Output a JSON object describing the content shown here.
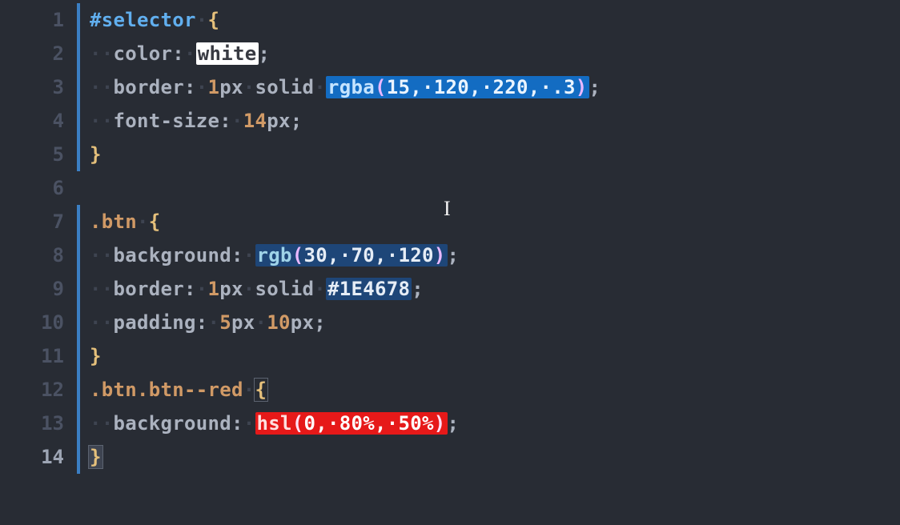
{
  "colors": {
    "background": "#282c34",
    "gutter": "#4b5263",
    "foldbar": "#3b7fc4",
    "sel": "#61afef",
    "class": "#d19a66",
    "brace": "#e5c07b",
    "num": "#d19a66",
    "func": "#56b6c2",
    "paren": "#c678dd"
  },
  "swatches": {
    "white": "#ffffff",
    "rgba": "rgba(15, 120, 220, .3)",
    "rgb": "rgb(30, 70, 120)",
    "hex": "#1E4678",
    "hsl": "hsl(0, 80%, 50%)"
  },
  "lines": [
    {
      "n": "1",
      "fold": true,
      "tokens": [
        {
          "t": "#selector",
          "c": "tk-sel"
        },
        {
          "t": "·",
          "c": "tk-ws"
        },
        {
          "t": "{",
          "c": "tk-brace"
        }
      ]
    },
    {
      "n": "2",
      "fold": true,
      "tokens": [
        {
          "t": "··",
          "c": "tk-ws"
        },
        {
          "t": "color",
          "c": "tk-prop"
        },
        {
          "t": ":",
          "c": "tk-punc"
        },
        {
          "t": "·",
          "c": "tk-ws"
        },
        {
          "sw": "sw-white",
          "inner": [
            {
              "t": "white",
              "c": "txt"
            }
          ]
        },
        {
          "t": ";",
          "c": "tk-punc"
        }
      ]
    },
    {
      "n": "3",
      "fold": true,
      "tokens": [
        {
          "t": "··",
          "c": "tk-ws"
        },
        {
          "t": "border",
          "c": "tk-prop"
        },
        {
          "t": ":",
          "c": "tk-punc"
        },
        {
          "t": "·",
          "c": "tk-ws"
        },
        {
          "t": "1",
          "c": "tk-num"
        },
        {
          "t": "px",
          "c": "tk-unit"
        },
        {
          "t": "·",
          "c": "tk-ws"
        },
        {
          "t": "solid",
          "c": "tk-keyw"
        },
        {
          "t": "·",
          "c": "tk-ws"
        },
        {
          "sw": "sw-rgba",
          "inner": [
            {
              "t": "rgba",
              "c": "tk-func"
            },
            {
              "t": "(",
              "c": "tk-paren"
            },
            {
              "t": "15",
              "c": "tk-num"
            },
            {
              "t": ",",
              "c": "txt"
            },
            {
              "t": "·",
              "c": "tk-ws"
            },
            {
              "t": "120",
              "c": "tk-num"
            },
            {
              "t": ",",
              "c": "txt"
            },
            {
              "t": "·",
              "c": "tk-ws"
            },
            {
              "t": "220",
              "c": "tk-num"
            },
            {
              "t": ",",
              "c": "txt"
            },
            {
              "t": "·",
              "c": "tk-ws"
            },
            {
              "t": ".3",
              "c": "tk-num"
            },
            {
              "t": ")",
              "c": "tk-paren"
            }
          ]
        },
        {
          "t": ";",
          "c": "tk-punc"
        }
      ]
    },
    {
      "n": "4",
      "fold": true,
      "tokens": [
        {
          "t": "··",
          "c": "tk-ws"
        },
        {
          "t": "font-size",
          "c": "tk-prop"
        },
        {
          "t": ":",
          "c": "tk-punc"
        },
        {
          "t": "·",
          "c": "tk-ws"
        },
        {
          "t": "14",
          "c": "tk-num"
        },
        {
          "t": "px",
          "c": "tk-unit"
        },
        {
          "t": ";",
          "c": "tk-punc"
        }
      ]
    },
    {
      "n": "5",
      "fold": true,
      "tokens": [
        {
          "t": "}",
          "c": "tk-brace"
        }
      ]
    },
    {
      "n": "6",
      "fold": false,
      "tokens": []
    },
    {
      "n": "7",
      "fold": true,
      "tokens": [
        {
          "t": ".btn",
          "c": "tk-class"
        },
        {
          "t": "·",
          "c": "tk-ws"
        },
        {
          "t": "{",
          "c": "tk-brace"
        }
      ]
    },
    {
      "n": "8",
      "fold": true,
      "tokens": [
        {
          "t": "··",
          "c": "tk-ws"
        },
        {
          "t": "background",
          "c": "tk-prop"
        },
        {
          "t": ":",
          "c": "tk-punc"
        },
        {
          "t": "·",
          "c": "tk-ws"
        },
        {
          "sw": "sw-rgb",
          "inner": [
            {
              "t": "rgb",
              "c": "tk-func"
            },
            {
              "t": "(",
              "c": "tk-paren"
            },
            {
              "t": "30",
              "c": "tk-num"
            },
            {
              "t": ",",
              "c": "txt"
            },
            {
              "t": "·",
              "c": "tk-ws"
            },
            {
              "t": "70",
              "c": "tk-num"
            },
            {
              "t": ",",
              "c": "txt"
            },
            {
              "t": "·",
              "c": "tk-ws"
            },
            {
              "t": "120",
              "c": "tk-num"
            },
            {
              "t": ")",
              "c": "tk-paren"
            }
          ]
        },
        {
          "t": ";",
          "c": "tk-punc"
        }
      ]
    },
    {
      "n": "9",
      "fold": true,
      "tokens": [
        {
          "t": "··",
          "c": "tk-ws"
        },
        {
          "t": "border",
          "c": "tk-prop"
        },
        {
          "t": ":",
          "c": "tk-punc"
        },
        {
          "t": "·",
          "c": "tk-ws"
        },
        {
          "t": "1",
          "c": "tk-num"
        },
        {
          "t": "px",
          "c": "tk-unit"
        },
        {
          "t": "·",
          "c": "tk-ws"
        },
        {
          "t": "solid",
          "c": "tk-keyw"
        },
        {
          "t": "·",
          "c": "tk-ws"
        },
        {
          "sw": "sw-hex",
          "inner": [
            {
              "t": "#1E4678",
              "c": "txt"
            }
          ]
        },
        {
          "t": ";",
          "c": "tk-punc"
        }
      ]
    },
    {
      "n": "10",
      "fold": true,
      "tokens": [
        {
          "t": "··",
          "c": "tk-ws"
        },
        {
          "t": "padding",
          "c": "tk-prop"
        },
        {
          "t": ":",
          "c": "tk-punc"
        },
        {
          "t": "·",
          "c": "tk-ws"
        },
        {
          "t": "5",
          "c": "tk-num"
        },
        {
          "t": "px",
          "c": "tk-unit"
        },
        {
          "t": "·",
          "c": "tk-ws"
        },
        {
          "t": "10",
          "c": "tk-num"
        },
        {
          "t": "px",
          "c": "tk-unit"
        },
        {
          "t": ";",
          "c": "tk-punc"
        }
      ]
    },
    {
      "n": "11",
      "fold": true,
      "tokens": [
        {
          "t": "}",
          "c": "tk-brace"
        }
      ]
    },
    {
      "n": "12",
      "fold": true,
      "tokens": [
        {
          "t": ".btn.btn--red",
          "c": "tk-class"
        },
        {
          "t": "·",
          "c": "tk-ws"
        },
        {
          "t": "{",
          "c": "tk-brace brace-match"
        }
      ]
    },
    {
      "n": "13",
      "fold": true,
      "tokens": [
        {
          "t": "··",
          "c": "tk-ws"
        },
        {
          "t": "background",
          "c": "tk-prop"
        },
        {
          "t": ":",
          "c": "tk-punc"
        },
        {
          "t": "·",
          "c": "tk-ws"
        },
        {
          "sw": "sw-hsl",
          "inner": [
            {
              "t": "hsl",
              "c": "tk-func"
            },
            {
              "t": "(",
              "c": "tk-paren"
            },
            {
              "t": "0",
              "c": "tk-num"
            },
            {
              "t": ",",
              "c": "txt"
            },
            {
              "t": "·",
              "c": "tk-ws"
            },
            {
              "t": "80%",
              "c": "tk-num"
            },
            {
              "t": ",",
              "c": "txt"
            },
            {
              "t": "·",
              "c": "tk-ws"
            },
            {
              "t": "50%",
              "c": "tk-num"
            },
            {
              "t": ")",
              "c": "tk-paren"
            }
          ]
        },
        {
          "t": ";",
          "c": "tk-punc"
        }
      ]
    },
    {
      "n": "14",
      "fold": true,
      "active": true,
      "tokens": [
        {
          "t": "}",
          "c": "tk-brace cursor-brace"
        }
      ]
    }
  ]
}
